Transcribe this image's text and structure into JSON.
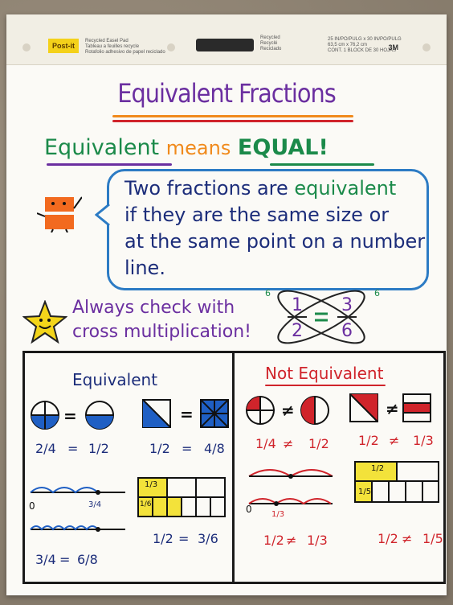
{
  "pad": {
    "brand": "Post-it",
    "product_lines": [
      "Recycled Easel Pad",
      "Tableau a feuilles recycle",
      "Rotafolio adhesivo de papel reciclado"
    ],
    "recycled_lines": [
      "Recycled",
      "Recyclé",
      "Reciclado"
    ],
    "size_lines": [
      "25 IN/PO/PULG x 30 IN/PO/PULG",
      "63,5 cm x 76,2 cm",
      "CONT. 1 BLOCK DE 30 HOJAS"
    ],
    "maker": "3M"
  },
  "poster": {
    "title": "Equivalent Fractions",
    "line2": {
      "word1": "Equivalent",
      "word2": "means",
      "word3": "EQUAL!"
    },
    "definition": {
      "lines": [
        {
          "a": "Two fractions are ",
          "b": "equivalent"
        },
        {
          "a": "if they are the same size or",
          "b": ""
        },
        {
          "a": "at the same point on a number",
          "b": ""
        },
        {
          "a": "line.",
          "b": ""
        }
      ]
    },
    "tip": {
      "line1": "Always check with",
      "line2": "cross multiplication!"
    },
    "cross": {
      "n1": "1",
      "d1": "2",
      "n2": "3",
      "d2": "6",
      "p1": "6",
      "p2": "6"
    },
    "equivalent": {
      "title": "Equivalent",
      "ex1": {
        "a": "2/4",
        "b": "1/2",
        "op": "="
      },
      "ex2": {
        "a": "1/2",
        "b": "4/8",
        "op": "="
      },
      "ex3": {
        "a": "3/4",
        "b": "6/8",
        "op": "="
      },
      "ex4": {
        "a": "1/2",
        "b": "3/6",
        "op": "="
      },
      "bar_top": "1/3",
      "bar_cell": "1/6",
      "numline_zero": "0",
      "numline_mark": "3/4"
    },
    "not_equivalent": {
      "title": "Not Equivalent",
      "ex1": {
        "a": "1/4",
        "b": "1/2",
        "op": "≠"
      },
      "ex2": {
        "a": "1/2",
        "b": "1/3",
        "op": "≠"
      },
      "ex3": {
        "a": "1/2",
        "b": "1/3",
        "op": "≠"
      },
      "ex4": {
        "a": "1/2",
        "b": "1/5",
        "op": "≠"
      },
      "bar_top": "1/2",
      "bar_cell": "1/5",
      "numline_zero": "0",
      "numline_mark": "1/3"
    }
  },
  "colors": {
    "purple": "#6b2fa0",
    "green": "#1b8a4a",
    "orange": "#f08a1c",
    "blue": "#2c7bc4",
    "red": "#d0242b",
    "yellow": "#f3e23a"
  }
}
